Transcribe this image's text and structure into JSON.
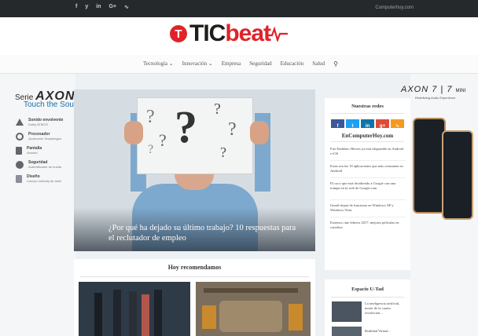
{
  "topbar": {
    "social": [
      "f",
      "y",
      "in",
      "G+",
      "rss"
    ],
    "site": "Computerhoy.com"
  },
  "logo": {
    "mark": "T",
    "tic": "TIC",
    "beat": "beat"
  },
  "nav": {
    "items": [
      "Tecnología",
      "Innovación",
      "Empresa",
      "Seguridad",
      "Educación",
      "Salud"
    ],
    "dropdown_marks": [
      "⌄",
      "⌄"
    ],
    "search_icon": "search-icon"
  },
  "ad": {
    "serie": "Serie",
    "axon": "AXON",
    "touch": "Touch the Sou",
    "features": [
      {
        "title": "Sonido envolvente",
        "sub": "Dolby ATMOS"
      },
      {
        "title": "Procesador",
        "sub": "Qualcomm Snapdragon"
      },
      {
        "title": "Pantalla",
        "sub": "Amoled"
      },
      {
        "title": "Seguridad",
        "sub": "Autentificador de huella"
      },
      {
        "title": "Diseño",
        "sub": "Cuerpo Unibody de alum"
      }
    ],
    "right_brand": "AXON",
    "right_models": "7 | 7",
    "right_mini": "MINI",
    "right_sub": "Redefining Audio Experience"
  },
  "hero": {
    "caption": "¿Por qué ha dejado su último trabajo? 10 respuestas para el reclutador de empleo"
  },
  "recommended": {
    "title": "Hoy recomendamos"
  },
  "sidebar": {
    "redes_title": "Nuestras redes",
    "redes_buttons": [
      "f",
      "t",
      "in",
      "g+",
      "rss"
    ],
    "redes_colors": [
      "#3b5998",
      "#1da1f2",
      "#0e76a8",
      "#dd4b39",
      "#f59a1e"
    ],
    "ech_title": "EnComputerHoy.com",
    "ech_items": [
      "Fire Emblem: Heroes ya está disponible en Android e iOS",
      "Estas son las 10 aplicaciones que más consumen en Android",
      "El cuco que está decidiendo a Google con una trampa en la web de Google.com",
      "Gmail dejará de funcionar en Windows XP y Windows Vista",
      "Estrenos cine febrero 2017: mejores películas en cartelera"
    ],
    "utad_title": "Espacio U-Tad",
    "utad_item": "La inteligencia artificial, motor de la cuarta revolución...",
    "utad_item2": "Realidad Virtual..."
  }
}
